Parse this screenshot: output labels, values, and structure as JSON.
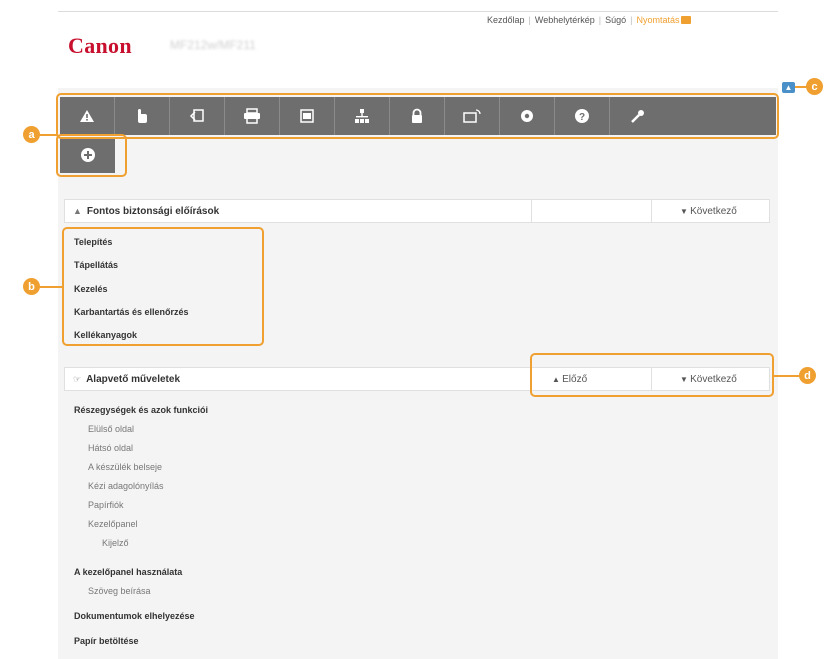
{
  "header": {
    "logo": "Canon",
    "model": "MF212w/MF211",
    "links": [
      "Kezdőlap",
      "Webhelytérkép",
      "Súgó"
    ],
    "print_label": "Nyomtatás"
  },
  "callouts": [
    "a",
    "b",
    "c",
    "d"
  ],
  "icon_bar": {
    "icons": [
      "warning-icon",
      "hand-pointer-icon",
      "copy-icon",
      "printer-icon",
      "scanner-icon",
      "network-icon",
      "lock-icon",
      "remote-ui-icon",
      "gear-icon",
      "help-icon",
      "wrench-icon"
    ],
    "extra_icon": "plus-circle-icon"
  },
  "section1": {
    "title": "Fontos biztonsági előírások",
    "next": "Következő"
  },
  "section1_links": [
    "Telepítés",
    "Tápellátás",
    "Kezelés",
    "Karbantartás és ellenőrzés",
    "Kellékanyagok"
  ],
  "section2": {
    "title": "Alapvető műveletek",
    "prev": "Előző",
    "next": "Következő"
  },
  "section2_links": [
    {
      "label": "Részegységek és azok funkciói",
      "level": 0
    },
    {
      "label": "Elülső oldal",
      "level": 1
    },
    {
      "label": "Hátsó oldal",
      "level": 1
    },
    {
      "label": "A készülék belseje",
      "level": 1
    },
    {
      "label": "Kézi adagolónyílás",
      "level": 1
    },
    {
      "label": "Papírfiók",
      "level": 1
    },
    {
      "label": "Kezelőpanel",
      "level": 1
    },
    {
      "label": "Kijelző",
      "level": 2
    },
    {
      "label": "A kezelőpanel használata",
      "level": 0
    },
    {
      "label": "Szöveg beírása",
      "level": 1
    },
    {
      "label": "Dokumentumok elhelyezése",
      "level": 0
    },
    {
      "label": "Papír betöltése",
      "level": 0
    }
  ],
  "colors": {
    "accent": "#f0a030",
    "brand": "#c8102e",
    "icon_bar": "#6e6e6e"
  }
}
